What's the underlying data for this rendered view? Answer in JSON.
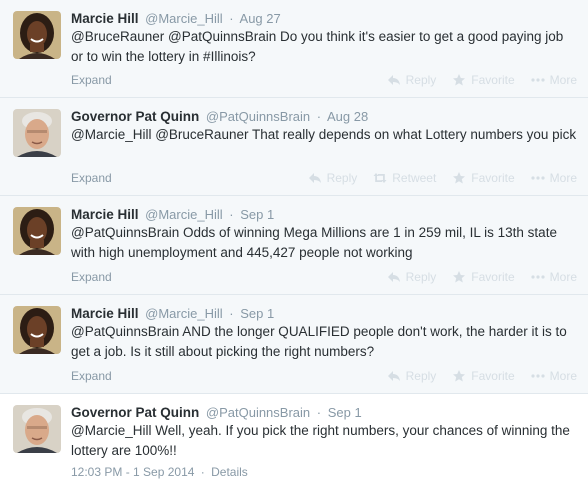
{
  "actions": {
    "reply": "Reply",
    "retweet": "Retweet",
    "favorite": "Favorite",
    "more": "More",
    "expand": "Expand"
  },
  "tweets": [
    {
      "fullname": "Marcie Hill",
      "username": "@Marcie_Hill",
      "separator": "·",
      "date": "Aug 27",
      "text": "@BruceRauner @PatQuinnsBrain Do you think it's easier to get a good paying job or to win the lottery in #Illinois?",
      "avatar": "marcie-avatar"
    },
    {
      "fullname": "Governor Pat Quinn",
      "username": "@PatQuinnsBrain",
      "separator": "·",
      "date": "Aug 28",
      "text": "@Marcie_Hill @BruceRauner That really depends on what Lottery numbers you pick",
      "avatar": "quinn-avatar"
    },
    {
      "fullname": "Marcie Hill",
      "username": "@Marcie_Hill",
      "separator": "·",
      "date": "Sep 1",
      "text": "@PatQuinnsBrain Odds of winning Mega Millions are 1 in 259 mil, IL is 13th state with high unemployment and 445,427 people not working",
      "avatar": "marcie-avatar"
    },
    {
      "fullname": "Marcie Hill",
      "username": "@Marcie_Hill",
      "separator": "·",
      "date": "Sep 1",
      "text": "@PatQuinnsBrain AND the longer QUALIFIED people don't work, the harder it is to get a job. Is it still about picking the right numbers?",
      "avatar": "marcie-avatar"
    },
    {
      "fullname": "Governor Pat Quinn",
      "username": "@PatQuinnsBrain",
      "separator": "·",
      "date": "Sep 1",
      "text": "@Marcie_Hill Well, yeah.  If you pick the right numbers, your chances of winning the lottery are 100%!!",
      "timestamp": "12:03 PM - 1 Sep 2014",
      "meta_separator": "·",
      "details": "Details",
      "avatar": "quinn-avatar"
    }
  ],
  "colors": {
    "background_collapsed": "#f5f8fa",
    "background_expanded": "#ffffff",
    "text": "#292f33",
    "muted": "#8899a6",
    "action_faded": "#d6dee4",
    "border": "#e1e8ed"
  },
  "icons": {
    "reply": "reply-icon",
    "retweet": "retweet-icon",
    "favorite": "star-icon",
    "more": "more-dots-icon"
  }
}
